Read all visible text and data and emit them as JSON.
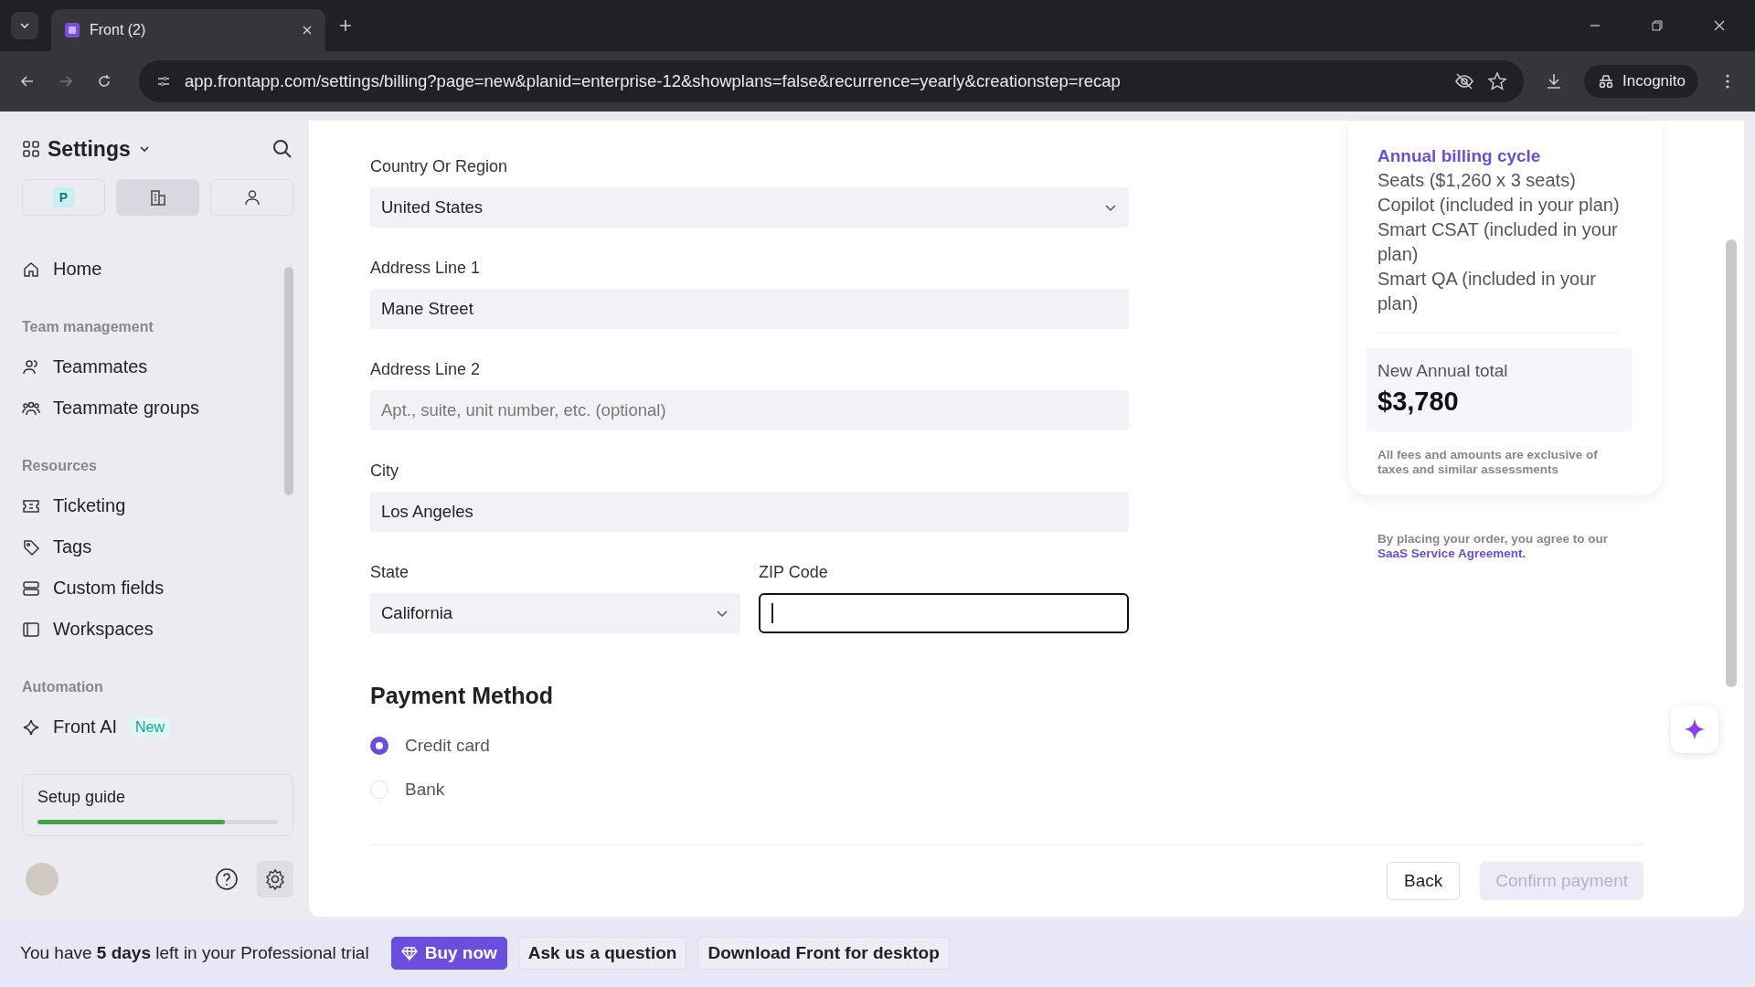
{
  "browser": {
    "tab_title": "Front (2)",
    "url": "app.frontapp.com/settings/billing?page=new&planid=enterprise-12&showplans=false&recurrence=yearly&creationstep=recap",
    "profile_label": "Incognito"
  },
  "sidebar": {
    "title": "Settings",
    "scope_tabs": [
      {
        "kind": "personal",
        "label": "P",
        "selected": false
      },
      {
        "kind": "company",
        "selected": true
      },
      {
        "kind": "user",
        "selected": false
      }
    ],
    "sections": [
      {
        "items": [
          {
            "label": "Home"
          }
        ]
      },
      {
        "heading": "Team management",
        "items": [
          {
            "label": "Teammates"
          },
          {
            "label": "Teammate groups"
          }
        ]
      },
      {
        "heading": "Resources",
        "items": [
          {
            "label": "Ticketing"
          },
          {
            "label": "Tags"
          },
          {
            "label": "Custom fields"
          },
          {
            "label": "Workspaces"
          }
        ]
      },
      {
        "heading": "Automation",
        "items": [
          {
            "label": "Front AI",
            "badge": "New"
          }
        ]
      }
    ],
    "setup_guide": {
      "label": "Setup guide",
      "level": 0.78
    }
  },
  "form": {
    "fields": [
      {
        "kind": "select",
        "label": "Country Or Region",
        "value": "United States"
      },
      {
        "kind": "text",
        "label": "Address Line 1",
        "value": "Mane Street"
      },
      {
        "kind": "text",
        "label": "Address Line 2",
        "placeholder": "Apt., suite, unit number, etc. (optional)"
      },
      {
        "kind": "text",
        "label": "City",
        "value": "Los Angeles"
      }
    ],
    "pair": [
      {
        "kind": "select",
        "label": "State",
        "value": "California",
        "focused": false
      },
      {
        "kind": "text",
        "label": "ZIP Code",
        "focused": true
      }
    ],
    "payment_heading": "Payment Method",
    "payment_options": [
      {
        "label": "Credit card",
        "selected": true
      },
      {
        "label": "Bank",
        "selected": false
      }
    ]
  },
  "summary": {
    "heading": "Annual billing cycle",
    "lines": [
      "Seats ($1,260 x 3 seats)",
      "Copilot (included in your plan)",
      "Smart CSAT (included in your plan)",
      "Smart QA (included in your plan)"
    ],
    "total_label": "New Annual total",
    "total": "$3,780",
    "note": "All fees and amounts are exclusive of taxes and similar assessments",
    "agreement": "By placing your order, you agree to our",
    "agreement_link": "SaaS Service Agreement."
  },
  "actions": [
    {
      "label": "Back",
      "disabled": false
    },
    {
      "label": "Confirm payment",
      "disabled": true
    }
  ],
  "trial_bar": {
    "message": "You have **5 days** left in your Professional trial",
    "buttons": [
      {
        "kind": "primary",
        "label": "Buy now"
      },
      {
        "kind": "plain",
        "label": "Ask us a question"
      },
      {
        "kind": "plain",
        "label": "Download Front for desktop"
      }
    ]
  }
}
